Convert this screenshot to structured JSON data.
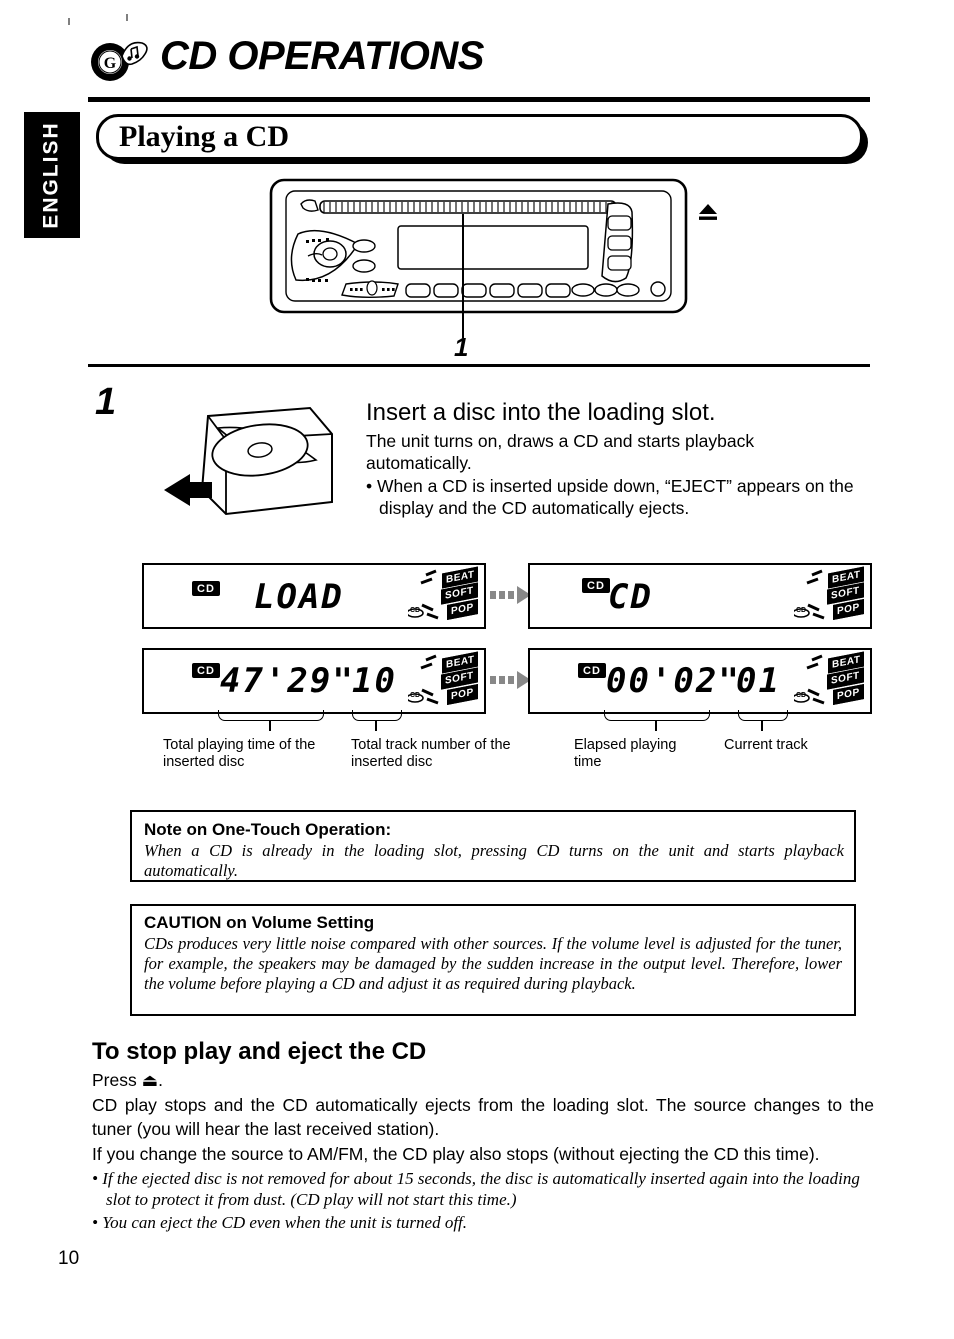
{
  "page": {
    "number": "10",
    "language_tab": "ENGLISH",
    "chapter_title": "CD OPERATIONS",
    "section_title": "Playing a CD"
  },
  "icons": {
    "chapter": "cd-disc-music-note-icon",
    "eject": "eject-triangle-icon",
    "unit": "car-stereo-faceplate-icon",
    "insert": "disc-insert-slot-icon",
    "arrow": "dashed-arrow-icon"
  },
  "callout": {
    "number": "1"
  },
  "step": {
    "number": "1",
    "heading": "Insert a disc into the loading slot.",
    "body_line1": "The unit turns on, draws a CD and starts playback",
    "body_line2": "automatically.",
    "bullet": "• When a CD is inserted upside down, “EJECT” appears on the display and the CD automatically ejects."
  },
  "displays": [
    {
      "name": "loading",
      "cd_indicator": "CD",
      "main": "LOAD",
      "secondary": "",
      "eq_tags": [
        "BEAT",
        "SOFT",
        "POP"
      ],
      "disc_glyph": "CD"
    },
    {
      "name": "cd-detected",
      "cd_indicator": "CD",
      "main": "CD",
      "secondary": "",
      "eq_tags": [
        "BEAT",
        "SOFT",
        "POP"
      ],
      "disc_glyph": "CD"
    },
    {
      "name": "disc-info",
      "cd_indicator": "CD",
      "main": "47'29\"",
      "secondary": "10",
      "eq_tags": [
        "BEAT",
        "SOFT",
        "POP"
      ],
      "disc_glyph": "CD"
    },
    {
      "name": "playing",
      "cd_indicator": "CD",
      "main": "00'02\"",
      "secondary": "01",
      "eq_tags": [
        "BEAT",
        "SOFT",
        "POP"
      ],
      "disc_glyph": "CD"
    }
  ],
  "captions": {
    "total_time": "Total playing time of the inserted disc",
    "total_tracks": "Total track number of the inserted disc",
    "elapsed": "Elapsed playing time",
    "current_track": "Current track"
  },
  "note_box": {
    "title": "Note on One-Touch Operation:",
    "body": "When a CD is already in the loading slot, pressing CD turns on the unit and starts playback automatically."
  },
  "caution_box": {
    "title": "CAUTION on Volume Setting",
    "body": "CDs produces very little noise compared with other sources. If the volume level is adjusted for the tuner, for example, the speakers may be damaged by the sudden increase in the output level. Therefore, lower the volume before playing a CD and adjust it as required during playback."
  },
  "stop_section": {
    "heading": "To stop play and eject the CD",
    "press_line": "Press ⏏.",
    "para1": "CD play stops and the CD automatically ejects from the loading slot. The source changes to the tuner (you will hear the last received station).",
    "para2": "If you change the source to AM/FM, the CD play also stops (without ejecting the CD this time).",
    "bullet1": "• If the ejected disc is not removed for about 15 seconds, the disc is automatically inserted again into the loading slot to protect it from dust. (CD play will not start this time.)",
    "bullet2": "• You can eject the CD even when the unit is turned off."
  }
}
